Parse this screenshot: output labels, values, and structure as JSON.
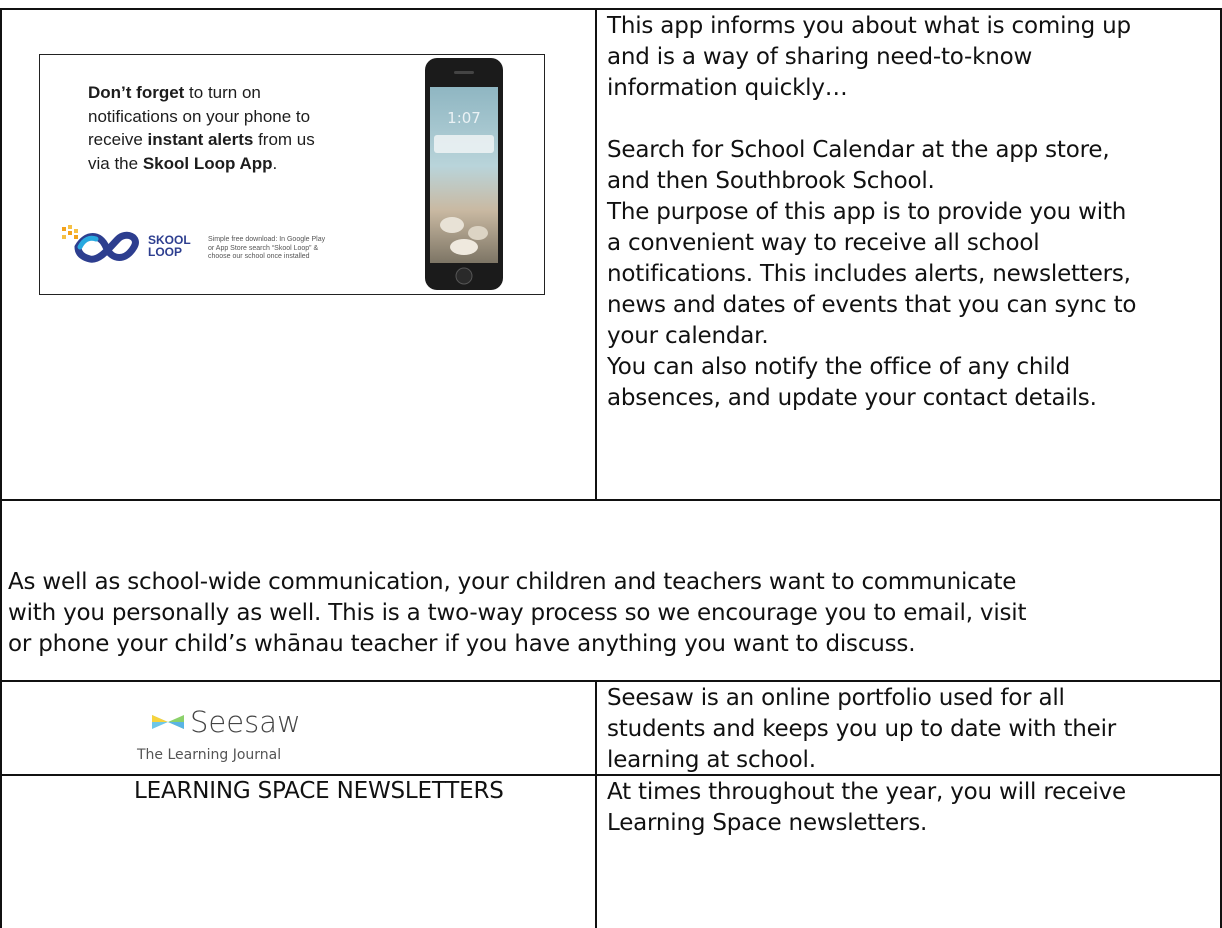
{
  "skool_loop_ad": {
    "line1_bold": "Don’t forget",
    "line1_rest": " to turn on",
    "line2": "notifications on your phone to",
    "line3_pre": "receive ",
    "line3_bold": "instant alerts",
    "line3_post": " from us",
    "line4_pre": "via the ",
    "line4_bold": "Skool Loop App",
    "line4_post": ".",
    "brand_line1": "SKOOL",
    "brand_line2": "LOOP",
    "download_line1": "Simple free download: In Google Play",
    "download_line2": "or App Store search “Skool Loop” &",
    "download_line3": "choose our school once installed",
    "phone_time": "1:07",
    "logo_icon": "infinity-icon",
    "phone_icon": "smartphone-icon"
  },
  "skool_loop_text": {
    "lines": [
      "This app informs you about what is coming up",
      "and is a way of sharing need-to-know",
      "information quickly…",
      "",
      "Search for School Calendar at the app store,",
      "and then Southbrook School.",
      "The purpose of this app is to provide you with",
      "a convenient way to receive all school",
      "notifications.  This includes alerts, newsletters,",
      "news and dates of events that you can sync to",
      "your calendar.",
      "You can also notify the office of any child",
      "absences, and update your contact details."
    ]
  },
  "personal_communication": {
    "lines": [
      "As well as school-wide communication, your children and teachers want to communicate",
      "with you personally as well.  This is a two-way process so we encourage you to email, visit",
      "or phone your child’s whānau teacher if you have anything you want to discuss."
    ]
  },
  "seesaw": {
    "name": "Seesaw",
    "tagline": "The Learning Journal",
    "logo_icon": "seesaw-logo-icon",
    "lines": [
      "Seesaw is an online portfolio used for all",
      "students and keeps you up to date with their",
      "learning at school."
    ]
  },
  "newsletters": {
    "heading": "LEARNING SPACE NEWSLETTERS",
    "lines": [
      "At times throughout the year, you will receive",
      "Learning Space newsletters."
    ]
  },
  "colors": {
    "border": "#111111",
    "skool_blue": "#2d3e8f",
    "skool_orange": "#f3a21b",
    "seesaw_text": "#444444"
  }
}
